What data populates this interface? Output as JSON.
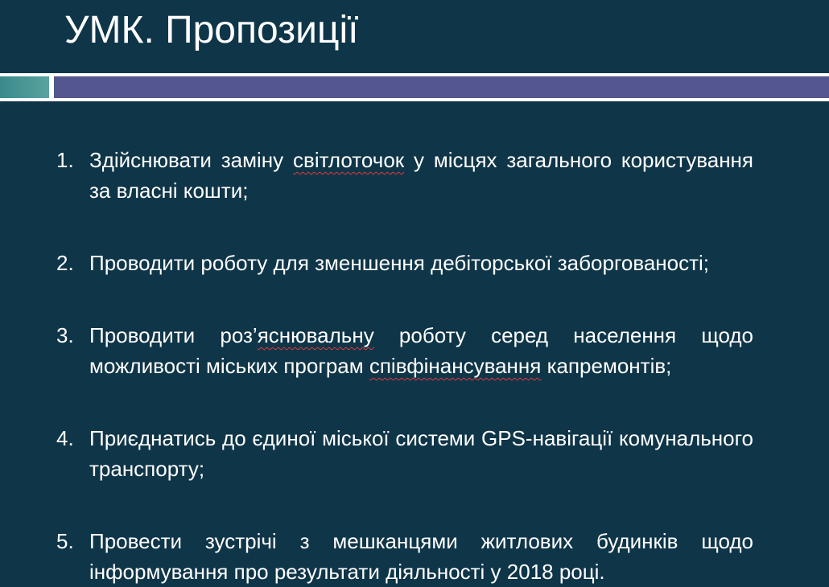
{
  "slide": {
    "title": "УМК. Пропозиції",
    "colors": {
      "background": "#0f3548",
      "title_text": "#ffffff",
      "body_text": "#ffffff",
      "divider_white": "#ffffff",
      "divider_teal": "#4a9896",
      "divider_purple": "#535690",
      "spellcheck_underline": "#e23a3a"
    },
    "items": [
      {
        "number": "1.",
        "text_a": "Здійснювати заміну ",
        "flagged_a": "світлоточок",
        "text_b": " у місцях загального користування за власні кошти;"
      },
      {
        "number": "2.",
        "text_a": "Проводити роботу для зменшення дебіторської заборгованості;"
      },
      {
        "number": "3.",
        "text_a": "Проводити роз’",
        "flagged_a": "яснювальну",
        "text_b": " роботу серед населення щодо можливості міських програм ",
        "flagged_b": "співфінансування",
        "text_c": " капремонтів;"
      },
      {
        "number": "4.",
        "text_a": "Приєднатись до єдиної міської системи GPS-навігації комунального транспорту;"
      },
      {
        "number": "5.",
        "text_a": "Провести зустрічі з мешканцями житлових будинків щодо інформування про результати діяльності у 2018 році."
      }
    ]
  }
}
